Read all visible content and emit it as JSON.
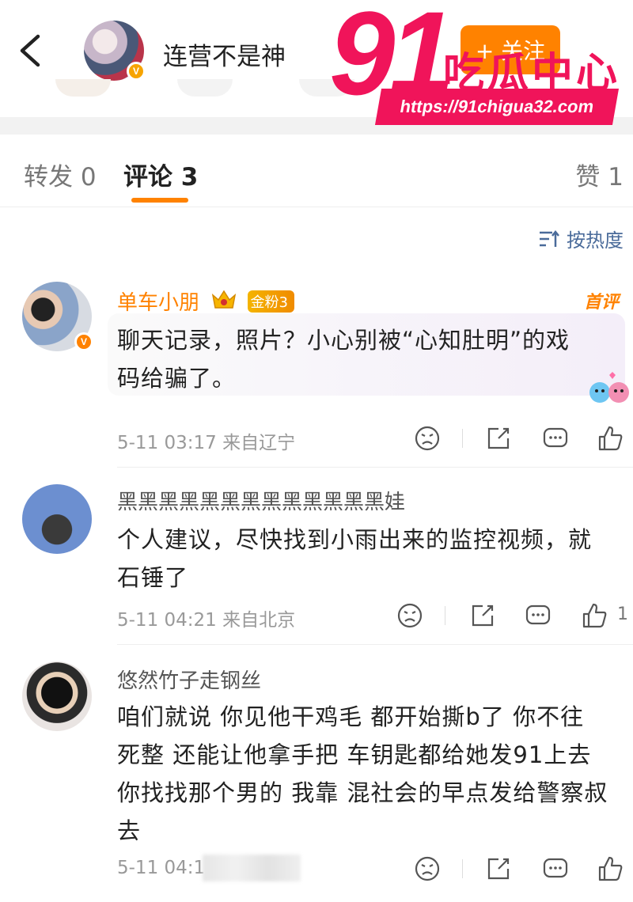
{
  "header": {
    "account_name": "连营不是神",
    "follow_label": "+ 关注"
  },
  "watermark": {
    "number": "91",
    "text": "吃瓜中心",
    "url": "https://91chigua32.com"
  },
  "tabs": [
    {
      "label": "转发 0"
    },
    {
      "label": "评论 3"
    },
    {
      "label": "赞 1"
    }
  ],
  "sort_label": "按热度",
  "comments": [
    {
      "author": "单车小朋",
      "fan_badge": "金粉3",
      "tag": "首评",
      "text_lines": [
        "聊天记录，照片？小心别被“心知肚明”的戏",
        "码给骗了。"
      ],
      "meta": "5-11 03:17 来自辽宁",
      "likes": ""
    },
    {
      "author": "黑黑黑黑黑黑黑黑黑黑黑黑黑娃",
      "text_lines": [
        "个人建议，尽快找到小雨出来的监控视频，就",
        "石锤了"
      ],
      "meta": "5-11 04:21 来自北京",
      "likes": "1"
    },
    {
      "author": "悠然竹子走钢丝",
      "text_lines": [
        "咱们就说 你见他干鸡毛 都开始撕b了 你不往",
        "死整 还能让他拿手把 车钥匙都给她发91上去",
        "你找找那个男的 我靠 混社会的早点发给警察叔",
        "去"
      ],
      "meta": "5-11 04:1",
      "likes": ""
    }
  ],
  "colors": {
    "accent": "#ff8200",
    "watermark": "#f0145a",
    "link": "#4a6b9a"
  }
}
